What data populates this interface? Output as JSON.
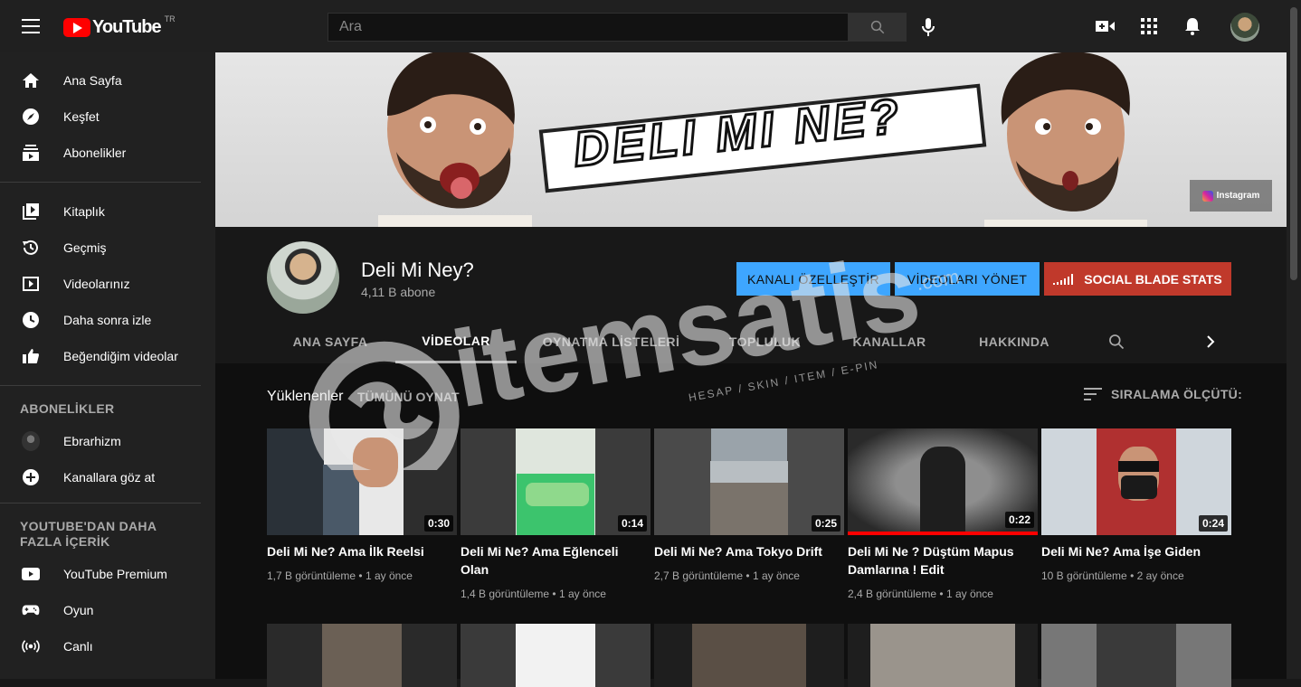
{
  "header": {
    "logo_text": "YouTube",
    "region": "TR",
    "search_placeholder": "Ara"
  },
  "sidebar": {
    "main": [
      {
        "label": "Ana Sayfa",
        "icon": "home-icon"
      },
      {
        "label": "Keşfet",
        "icon": "compass-icon"
      },
      {
        "label": "Abonelikler",
        "icon": "subscriptions-icon"
      }
    ],
    "library": [
      {
        "label": "Kitaplık",
        "icon": "library-icon"
      },
      {
        "label": "Geçmiş",
        "icon": "history-icon"
      },
      {
        "label": "Videolarınız",
        "icon": "your-videos-icon"
      },
      {
        "label": "Daha sonra izle",
        "icon": "watch-later-icon"
      },
      {
        "label": "Beğendiğim videolar",
        "icon": "like-icon"
      }
    ],
    "subscriptions_heading": "ABONELİKLER",
    "subscriptions": [
      {
        "label": "Ebrarhizm",
        "icon": "channel-avatar-icon"
      },
      {
        "label": "Kanallara göz at",
        "icon": "add-circle-icon"
      }
    ],
    "more_heading": "YOUTUBE'DAN DAHA FAZLA İÇERİK",
    "more": [
      {
        "label": "YouTube Premium",
        "icon": "youtube-icon"
      },
      {
        "label": "Oyun",
        "icon": "gamepad-icon"
      },
      {
        "label": "Canlı",
        "icon": "live-icon"
      }
    ]
  },
  "banner": {
    "title": "DELI MI NE?",
    "instagram_label": "Instagram"
  },
  "channel": {
    "name": "Deli Mi Ney?",
    "subscribers": "4,11 B abone",
    "customize_label": "KANALI ÖZELLEŞTİR",
    "manage_label": "VİDEOLARI YÖNET",
    "socialblade_label": "SOCIAL BLADE STATS"
  },
  "tabs": [
    "ANA SAYFA",
    "VİDEOLAR",
    "OYNATMA LİSTELERİ",
    "TOPLULUK",
    "KANALLAR",
    "HAKKINDA"
  ],
  "active_tab": "VİDEOLAR",
  "section": {
    "title": "Yüklenenler",
    "play_all": "TÜMÜNÜ OYNAT",
    "sort_label": "SIRALAMA ÖLÇÜTÜ:"
  },
  "videos": [
    {
      "title": "Deli Mi Ne? Ama İlk Reelsi",
      "duration": "0:30",
      "views": "1,7 B görüntüleme",
      "age": "1 ay önce"
    },
    {
      "title": "Deli Mi Ne? Ama Eğlenceli Olan",
      "duration": "0:14",
      "views": "1,4 B görüntüleme",
      "age": "1 ay önce"
    },
    {
      "title": "Deli Mi Ne? Ama Tokyo Drift",
      "duration": "0:25",
      "views": "2,7 B görüntüleme",
      "age": "1 ay önce"
    },
    {
      "title": "Deli Mi Ne ? Düştüm Mapus Damlarına ! Edit",
      "duration": "0:22",
      "views": "2,4 B görüntüleme",
      "age": "1 ay önce"
    },
    {
      "title": "Deli Mi Ne? Ama İşe Giden",
      "duration": "0:24",
      "views": "10 B görüntüleme",
      "age": "2 ay önce"
    }
  ],
  "watermark": {
    "text": "itemsatis",
    "subtext": "HESAP / SKIN / ITEM / E-PIN",
    "domain": ".com"
  },
  "colors": {
    "accent_blue": "#3ea6ff",
    "social_blade_red": "#c0392b",
    "youtube_red": "#ff0000"
  }
}
